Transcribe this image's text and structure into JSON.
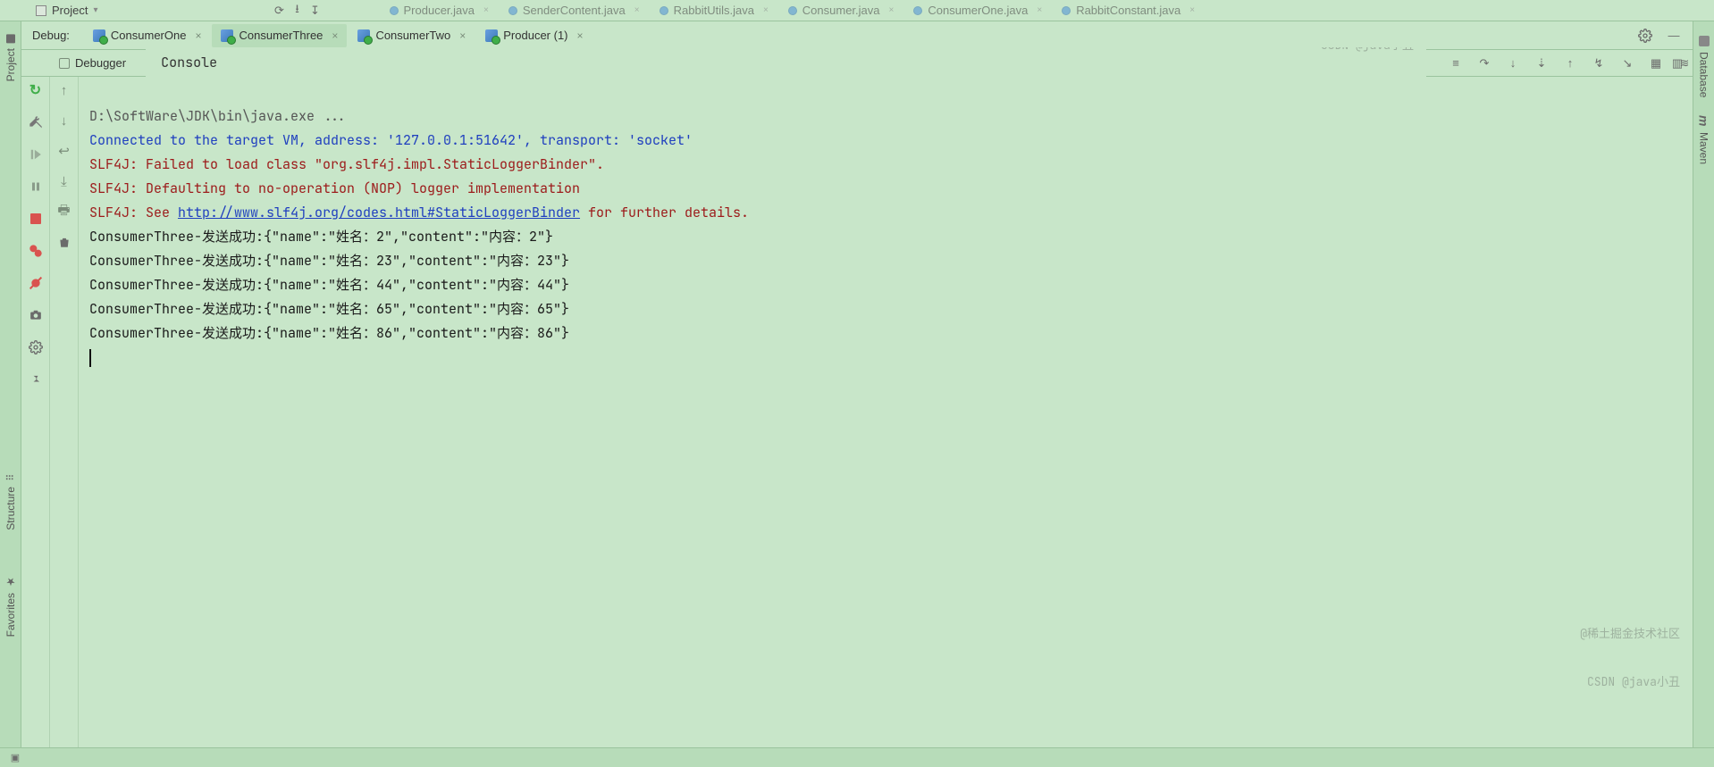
{
  "top": {
    "project_label": "Project",
    "file_tabs": [
      "Producer.java",
      "SenderContent.java",
      "RabbitUtils.java",
      "Consumer.java",
      "ConsumerOne.java",
      "RabbitConstant.java"
    ]
  },
  "debug": {
    "label": "Debug:",
    "run_tabs": [
      {
        "name": "ConsumerOne"
      },
      {
        "name": "ConsumerThree"
      },
      {
        "name": "ConsumerTwo"
      },
      {
        "name": "Producer (1)"
      }
    ]
  },
  "inner": {
    "debugger_tab": "Debugger",
    "console_tab": "Console"
  },
  "sidebars": {
    "project": "Project",
    "structure": "Structure",
    "favorites": "Favorites",
    "database": "Database",
    "maven": "Maven"
  },
  "console": {
    "cmd": "D:\\SoftWare\\JDK\\bin\\java.exe ...",
    "connect": "Connected to the target VM, address: '127.0.0.1:51642', transport: 'socket'",
    "slf1": "SLF4J: Failed to load class \"org.slf4j.impl.StaticLoggerBinder\".",
    "slf2": "SLF4J: Defaulting to no-operation (NOP) logger implementation",
    "slf3_pre": "SLF4J: See ",
    "slf3_link": "http://www.slf4j.org/codes.html#StaticLoggerBinder",
    "slf3_post": " for further details.",
    "rows": [
      "ConsumerThree-发送成功:{\"name\":\"姓名：2\",\"content\":\"内容：2\"}",
      "ConsumerThree-发送成功:{\"name\":\"姓名：23\",\"content\":\"内容：23\"}",
      "ConsumerThree-发送成功:{\"name\":\"姓名：44\",\"content\":\"内容：44\"}",
      "ConsumerThree-发送成功:{\"name\":\"姓名：65\",\"content\":\"内容：65\"}",
      "ConsumerThree-发送成功:{\"name\":\"姓名：86\",\"content\":\"内容：86\"}"
    ]
  },
  "watermark": {
    "l1": "@稀土掘金技术社区",
    "l2": "CSDN @java小丑"
  }
}
